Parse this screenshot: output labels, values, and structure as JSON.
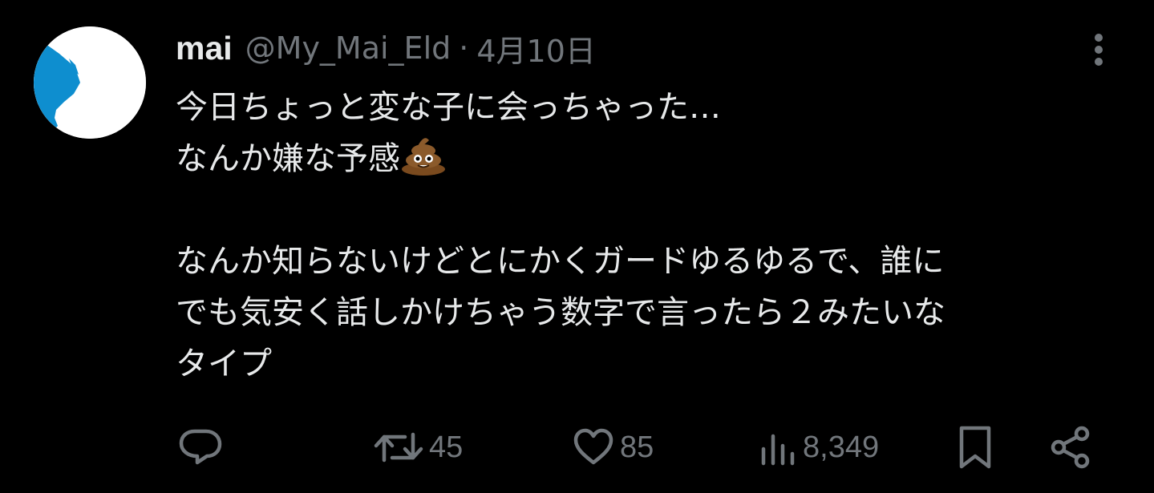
{
  "tweet": {
    "author": {
      "name": "mai",
      "handle": "@My_Mai_Eld",
      "avatar_icon": "avatar-image"
    },
    "separator": "·",
    "date": "4月10日",
    "body": {
      "line1": "今日ちょっと変な子に会っちゃった…",
      "line2": "なんか嫌な予感",
      "line2_emoji": "pile-of-poo-emoji",
      "line3": "なんか知らないけどとにかくガードゆるゆるで、誰に",
      "line4": "でも気安く話しかけちゃう数字で言ったら２みたいな",
      "line5": "タイプ"
    },
    "actions": {
      "reply": {
        "icon": "reply-icon",
        "count": ""
      },
      "retweet": {
        "icon": "retweet-icon",
        "count": "45"
      },
      "like": {
        "icon": "heart-icon",
        "count": "85"
      },
      "views": {
        "icon": "views-icon",
        "count": "8,349"
      },
      "bookmark": {
        "icon": "bookmark-icon"
      },
      "share": {
        "icon": "share-icon"
      }
    },
    "colors": {
      "background": "#000000",
      "text_primary": "#e7e9ea",
      "text_secondary": "#71767b",
      "avatar_accent": "#0e8ecf"
    }
  }
}
